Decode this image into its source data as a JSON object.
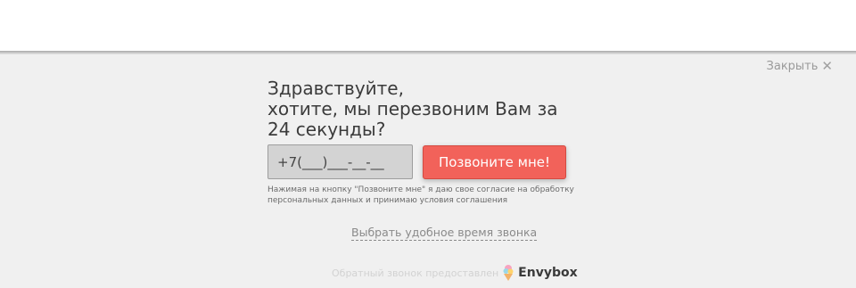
{
  "close": {
    "label": "Закрыть",
    "icon": "close-icon"
  },
  "headline": {
    "lines": [
      "Здравствуйте,",
      "хотите, мы перезвоним Вам за",
      "24 секунды?"
    ]
  },
  "phone": {
    "value": "+7(___)___-__-__"
  },
  "call_button": {
    "label": "Позвоните мне!"
  },
  "consent": {
    "lines": [
      "Нажимая на кнопку \"Позвоните мне\" я даю свое согласие на обработку",
      "персональных данных и принимаю условия соглашения"
    ]
  },
  "pick_time": {
    "label": "Выбрать удобное время звонка"
  },
  "footer": {
    "text": "Обратный звонок предоставлен",
    "brand": "Envybox"
  },
  "colors": {
    "accent": "#f2625a",
    "panel": "#f0f0f0",
    "text": "#3b3b3b"
  }
}
